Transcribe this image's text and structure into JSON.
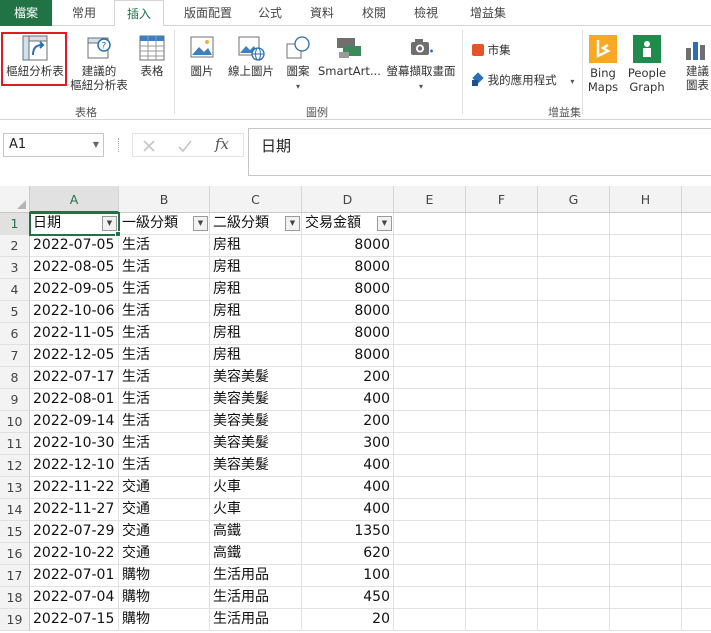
{
  "tabs": [
    {
      "label": "檔案"
    },
    {
      "label": "常用"
    },
    {
      "label": "插入"
    },
    {
      "label": "版面配置"
    },
    {
      "label": "公式"
    },
    {
      "label": "資料"
    },
    {
      "label": "校閱"
    },
    {
      "label": "檢視"
    },
    {
      "label": "增益集"
    }
  ],
  "ribbon": {
    "pivot_table": "樞紐分析表",
    "recommended_pivot": [
      "建議的",
      "樞紐分析表"
    ],
    "table": "表格",
    "picture": "圖片",
    "online_picture": "線上圖片",
    "shapes": "圖案",
    "smartart": "SmartArt...",
    "screenshot": "螢幕擷取畫面",
    "store": "市集",
    "my_apps": "我的應用程式",
    "bing_maps": [
      "Bing",
      "Maps"
    ],
    "people_graph": [
      "People",
      "Graph"
    ],
    "recommended_charts": [
      "建議",
      "圖表"
    ],
    "group_tables": "表格",
    "group_illustrations": "圖例",
    "group_addins": "增益集"
  },
  "colors": {
    "accent": "#217346",
    "highlight": "#e11b22",
    "bing": "#f8a825",
    "people": "#1f8b4c"
  },
  "formula_bar": {
    "name_box": "A1",
    "content": "日期",
    "cancel_icon": "cross-icon",
    "enter_icon": "check-icon",
    "fx": "fx"
  },
  "columns": [
    "A",
    "B",
    "C",
    "D",
    "E",
    "F",
    "G",
    "H"
  ],
  "headers": [
    "日期",
    "一級分類",
    "二級分類",
    "交易金額"
  ],
  "rows": [
    {
      "n": "2",
      "date": "2022-07-05",
      "cat1": "生活",
      "cat2": "房租",
      "amount": "8000"
    },
    {
      "n": "3",
      "date": "2022-08-05",
      "cat1": "生活",
      "cat2": "房租",
      "amount": "8000"
    },
    {
      "n": "4",
      "date": "2022-09-05",
      "cat1": "生活",
      "cat2": "房租",
      "amount": "8000"
    },
    {
      "n": "5",
      "date": "2022-10-06",
      "cat1": "生活",
      "cat2": "房租",
      "amount": "8000"
    },
    {
      "n": "6",
      "date": "2022-11-05",
      "cat1": "生活",
      "cat2": "房租",
      "amount": "8000"
    },
    {
      "n": "7",
      "date": "2022-12-05",
      "cat1": "生活",
      "cat2": "房租",
      "amount": "8000"
    },
    {
      "n": "8",
      "date": "2022-07-17",
      "cat1": "生活",
      "cat2": "美容美髮",
      "amount": "200"
    },
    {
      "n": "9",
      "date": "2022-08-01",
      "cat1": "生活",
      "cat2": "美容美髮",
      "amount": "400"
    },
    {
      "n": "10",
      "date": "2022-09-14",
      "cat1": "生活",
      "cat2": "美容美髮",
      "amount": "200"
    },
    {
      "n": "11",
      "date": "2022-10-30",
      "cat1": "生活",
      "cat2": "美容美髮",
      "amount": "300"
    },
    {
      "n": "12",
      "date": "2022-12-10",
      "cat1": "生活",
      "cat2": "美容美髮",
      "amount": "400"
    },
    {
      "n": "13",
      "date": "2022-11-22",
      "cat1": "交通",
      "cat2": "火車",
      "amount": "400"
    },
    {
      "n": "14",
      "date": "2022-11-27",
      "cat1": "交通",
      "cat2": "火車",
      "amount": "400"
    },
    {
      "n": "15",
      "date": "2022-07-29",
      "cat1": "交通",
      "cat2": "高鐵",
      "amount": "1350"
    },
    {
      "n": "16",
      "date": "2022-10-22",
      "cat1": "交通",
      "cat2": "高鐵",
      "amount": "620"
    },
    {
      "n": "17",
      "date": "2022-07-01",
      "cat1": "購物",
      "cat2": "生活用品",
      "amount": "100"
    },
    {
      "n": "18",
      "date": "2022-07-04",
      "cat1": "購物",
      "cat2": "生活用品",
      "amount": "450"
    },
    {
      "n": "19",
      "date": "2022-07-15",
      "cat1": "購物",
      "cat2": "生活用品",
      "amount": "20"
    }
  ]
}
